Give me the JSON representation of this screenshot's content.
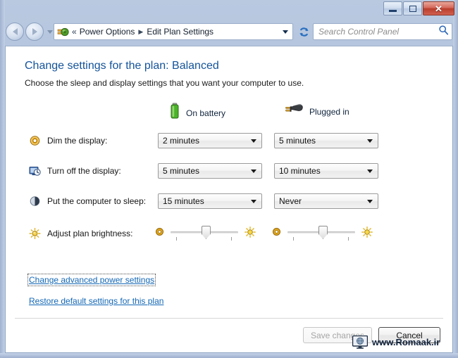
{
  "window": {
    "controls": {
      "minimize_label": "Minimize",
      "maximize_label": "Maximize",
      "close_label": "Close",
      "close_glyph": "✕"
    }
  },
  "navbar": {
    "back_label": "Back",
    "forward_label": "Forward",
    "recent_pages_label": "Recent pages",
    "breadcrumb": {
      "icon": "power-options-icon",
      "overflow_chevrons": "«",
      "items": [
        {
          "label": "Power Options"
        },
        {
          "label": "Edit Plan Settings"
        }
      ],
      "separator": "▶",
      "dropdown_label": "Previous locations"
    },
    "refresh_label": "Refresh",
    "search": {
      "placeholder": "Search Control Panel",
      "value": "",
      "icon": "search-icon"
    }
  },
  "page": {
    "title": "Change settings for the plan: Balanced",
    "subtitle": "Choose the sleep and display settings that you want your computer to use."
  },
  "columns": [
    {
      "key": "battery",
      "label": "On battery",
      "icon": "battery-icon"
    },
    {
      "key": "plugged",
      "label": "Plugged in",
      "icon": "power-plug-icon"
    }
  ],
  "settings_rows": [
    {
      "icon": "dim-display-icon",
      "label": "Dim the display:",
      "on_battery": "2 minutes",
      "plugged_in": "5 minutes"
    },
    {
      "icon": "turn-off-display-icon",
      "label": "Turn off the display:",
      "on_battery": "5 minutes",
      "plugged_in": "10 minutes"
    },
    {
      "icon": "sleep-icon",
      "label": "Put the computer to sleep:",
      "on_battery": "15 minutes",
      "plugged_in": "Never"
    }
  ],
  "brightness_row": {
    "icon": "brightness-icon",
    "label": "Adjust plan brightness:",
    "low_icon": "dim-brightness-icon",
    "high_icon": "bright-sun-icon",
    "on_battery_value": 52,
    "plugged_in_value": 52
  },
  "links": [
    {
      "label": "Change advanced power settings",
      "focused": true
    },
    {
      "label": "Restore default settings for this plan",
      "focused": false
    }
  ],
  "buttons": {
    "save": {
      "label": "Save changes",
      "disabled": true
    },
    "cancel": {
      "label": "Cancel",
      "disabled": false
    }
  },
  "watermark": {
    "text": "www.Romaak.ir",
    "icon": "globe-monitor-icon"
  },
  "colors": {
    "title_blue": "#14539a",
    "link_blue": "#1367b5",
    "frame_blue": "#b0c1dc",
    "close_red": "#b93d2c",
    "battery_green": "#4cb32b"
  }
}
